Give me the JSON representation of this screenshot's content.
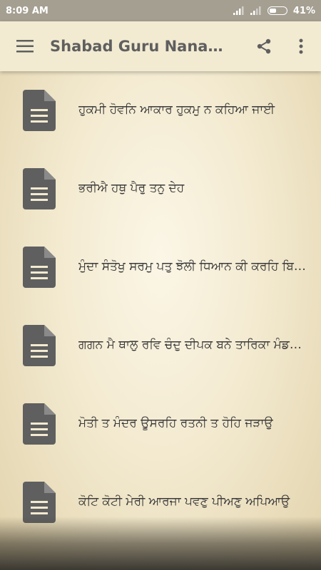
{
  "status_bar": {
    "time": "8:09 AM",
    "battery_percent": "41%",
    "battery_level": 0.41
  },
  "app_bar": {
    "title": "Shabad Guru Nanak Dev Ji",
    "menu_icon": "hamburger-menu-icon",
    "share_icon": "share-icon",
    "more_icon": "more-vert-icon"
  },
  "list": {
    "item_icon": "document-icon",
    "items": [
      {
        "label": "ਹੁਕਮੀ ਹੋਵਨਿ ਆਕਾਰ ਹੁਕਮੁ ਨ ਕਹਿਆ ਜਾਈ"
      },
      {
        "label": "ਭਰੀਐ ਹਥੁ ਪੈਰੁ ਤਨੁ ਦੇਹ"
      },
      {
        "label": "ਮੁੰਦਾ ਸੰਤੋਖੁ ਸਰਮੁ ਪਤੁ ਝੋਲੀ ਧਿਆਨ ਕੀ ਕਰਹਿ ਬਿਭੂਤਿ"
      },
      {
        "label": "ਗਗਨ ਮੈ ਥਾਲੁ ਰਵਿ ਚੰਦੁ ਦੀਪਕ ਬਨੇ ਤਾਰਿਕਾ ਮੰਡਲ ਜਨਕ ਮੋਤੀ"
      },
      {
        "label": "ਮੋਤੀ ਤ ਮੰਦਰ ਊਸਰਹਿ ਰਤਨੀ ਤ ਹੋਹਿ ਜੜਾਉ"
      },
      {
        "label": "ਕੋਟਿ ਕੋਟੀ ਮੇਰੀ ਆਰਜਾ ਪਵਣੁ ਪੀਅਣੁ ਅਪਿਆਉ"
      }
    ]
  },
  "colors": {
    "status_bar": "#a59f92",
    "app_bar": "#f2ebd2",
    "icon": "#5f5f5f",
    "text": "#3a3a3a"
  }
}
